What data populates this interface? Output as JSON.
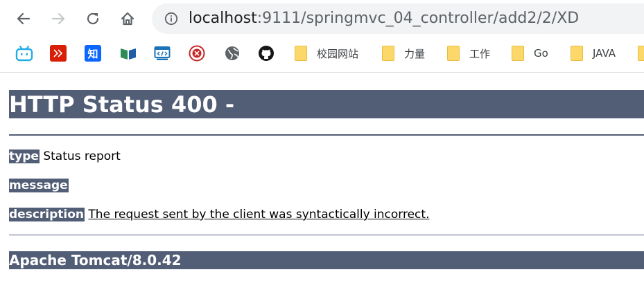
{
  "browser": {
    "url_host": "localhost",
    "url_rest": ":9111/springmvc_04_controller/add2/2/XD",
    "bookmarks": [
      {
        "icon": "bilibili-icon",
        "label": ""
      },
      {
        "icon": "red-logo-icon",
        "label": ""
      },
      {
        "icon": "zhihu-icon",
        "label": "知"
      },
      {
        "icon": "book-icon",
        "label": ""
      },
      {
        "icon": "code-window-icon",
        "label": ""
      },
      {
        "icon": "red-circle-logo-icon",
        "label": ""
      },
      {
        "icon": "globe-icon",
        "label": ""
      },
      {
        "icon": "github-icon",
        "label": ""
      },
      {
        "icon": "folder-icon",
        "label": "校园网站"
      },
      {
        "icon": "folder-icon",
        "label": "力量"
      },
      {
        "icon": "folder-icon",
        "label": "工作"
      },
      {
        "icon": "folder-icon",
        "label": "Go"
      },
      {
        "icon": "folder-icon",
        "label": "JAVA"
      }
    ]
  },
  "error_page": {
    "title": "HTTP Status 400 -",
    "type_label": "type",
    "type_value": "Status report",
    "message_label": "message",
    "message_value": "",
    "description_label": "description",
    "description_value": "The request sent by the client was syntactically incorrect.",
    "server": "Apache Tomcat/8.0.42"
  },
  "colors": {
    "tomcat_header": "#525d76",
    "folder": "#fcd86a"
  }
}
